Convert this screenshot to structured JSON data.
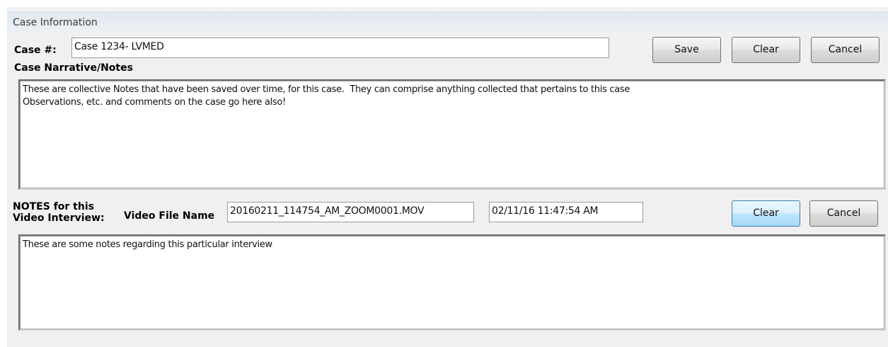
{
  "window": {
    "title": "Case Information"
  },
  "case": {
    "label": "Case #:",
    "value": "Case 1234- LVMED",
    "save_label": "Save",
    "clear_label": "Clear",
    "cancel_label": "Cancel",
    "narrative_label": "Case Narrative/Notes",
    "narrative_text": "These are collective Notes that have been saved over time, for this case.  They can comprise anything collected that pertains to this case\nObservations, etc. and comments on the case go here also!"
  },
  "interview": {
    "notes_label_line1": "NOTES for this",
    "notes_label_line2": "Video Interview:",
    "video_file_label": "Video File Name",
    "video_file_value": "20160211_114754_AM_ZOOM0001.MOV",
    "timestamp_value": "02/11/16 11:47:54 AM",
    "clear_label": "Clear",
    "cancel_label": "Cancel",
    "notes_text": "These are some notes regarding this particular interview"
  }
}
